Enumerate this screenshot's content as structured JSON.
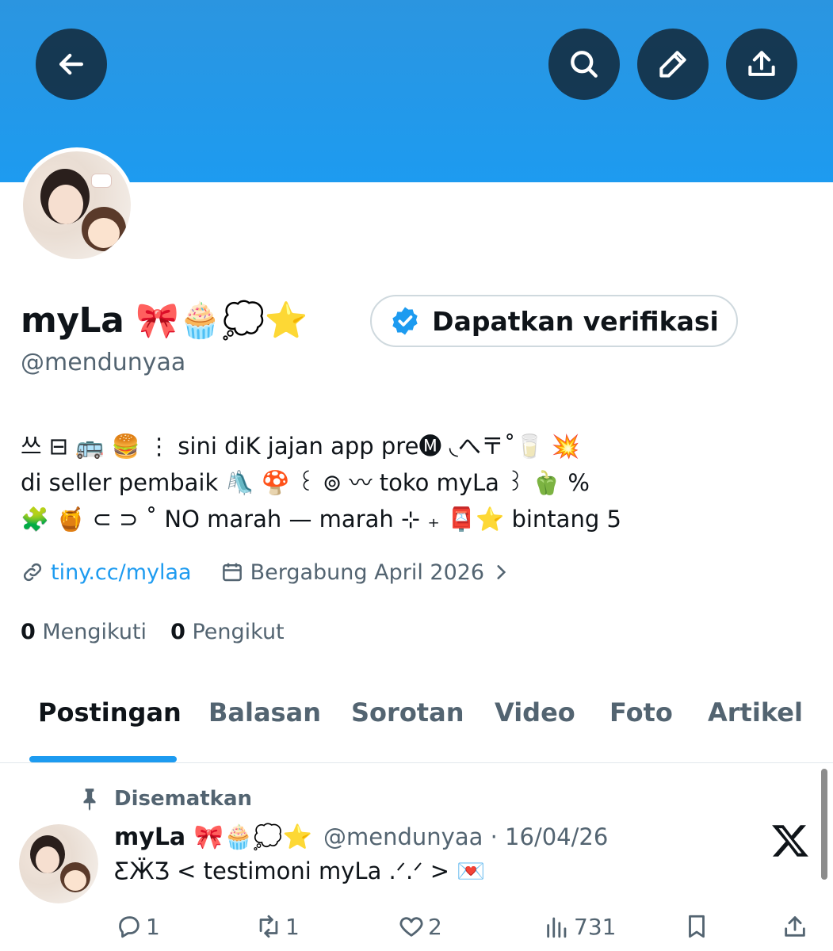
{
  "profile": {
    "display_name": "myLa 🎀🧁💭⭐",
    "handle": "@mendunyaa",
    "verify_label": "Dapatkan verifikasi",
    "bio_lines": [
      "쓰 ⊟ 🚌 🍔 ⋮ sini diK jajan app pre🅜 ◟へ〒˚🥛 💥",
      "di seller pembaik 🛝 🍄 ꒰ ⊚ 〰 toko myLa ꒱ 🫑 %",
      "🧩 🍯 ⊂ ⊃ ˚ NO marah — marah ⊹ ₊ 📮⭐ bintang 5"
    ],
    "link": "tiny.cc/mylaa",
    "joined": "Bergabung April 2026",
    "following_count": "0",
    "following_label": "Mengikuti",
    "followers_count": "0",
    "followers_label": "Pengikut"
  },
  "header": {
    "icons": [
      "back-arrow-icon",
      "search-icon",
      "pencil-icon",
      "share-icon"
    ]
  },
  "tabs": [
    "Postingan",
    "Balasan",
    "Sorotan",
    "Video",
    "Foto",
    "Artikel"
  ],
  "active_tab": "Postingan",
  "pinned_post": {
    "pinned_label": "Disematkan",
    "author_name": "myLa 🎀🧁💭⭐",
    "author_handle_date": "@mendunyaa · 16/04/26",
    "text": "ƸӜƷ < testimoni myLa .ᐟ.ᐟ > 💌",
    "replies": "1",
    "reposts": "1",
    "likes": "2",
    "views": "731"
  },
  "colors": {
    "banner": "#1d9bf0",
    "accent": "#1d9bf0",
    "secondary_text": "#536471"
  }
}
